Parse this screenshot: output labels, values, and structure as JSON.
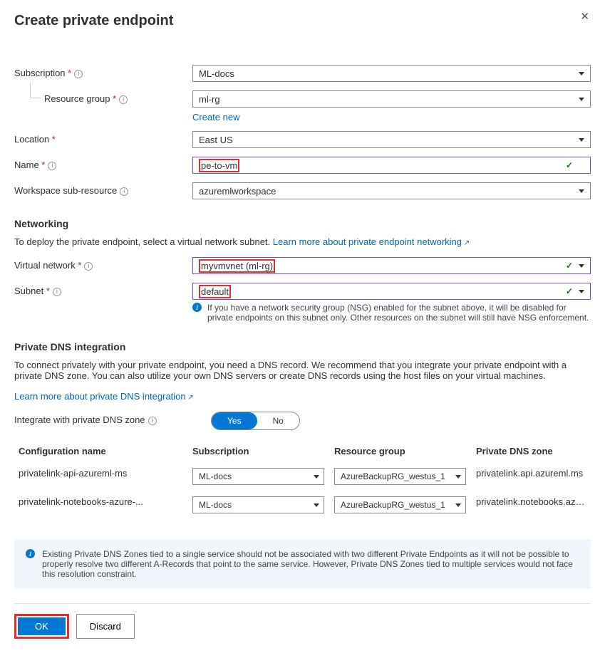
{
  "header": {
    "title": "Create private endpoint"
  },
  "fields": {
    "subscription": {
      "label": "Subscription",
      "value": "ML-docs"
    },
    "resourceGroup": {
      "label": "Resource group",
      "value": "ml-rg",
      "createNew": "Create new"
    },
    "location": {
      "label": "Location",
      "value": "East US"
    },
    "name": {
      "label": "Name",
      "value": "pe-to-vm"
    },
    "subresource": {
      "label": "Workspace sub-resource",
      "value": "azuremlworkspace"
    }
  },
  "networking": {
    "heading": "Networking",
    "desc": "To deploy the private endpoint, select a virtual network subnet. ",
    "learn": "Learn more about private endpoint networking",
    "vnet": {
      "label": "Virtual network",
      "value": "myvmvnet (ml-rg)"
    },
    "subnet": {
      "label": "Subnet",
      "value": "default"
    },
    "note": "If you have a network security group (NSG) enabled for the subnet above, it will be disabled for private endpoints on this subnet only. Other resources on the subnet will still have NSG enforcement."
  },
  "dns": {
    "heading": "Private DNS integration",
    "desc": "To connect privately with your private endpoint, you need a DNS record. We recommend that you integrate your private endpoint with a private DNS zone. You can also utilize your own DNS servers or create DNS records using the host files on your virtual machines.",
    "learn": "Learn more about private DNS integration",
    "toggleLabel": "Integrate with private DNS zone",
    "yes": "Yes",
    "no": "No",
    "cols": {
      "c1": "Configuration name",
      "c2": "Subscription",
      "c3": "Resource group",
      "c4": "Private DNS zone"
    },
    "rows": [
      {
        "name": "privatelink-api-azureml-ms",
        "sub": "ML-docs",
        "rg": "AzureBackupRG_westus_1",
        "zone": "privatelink.api.azureml.ms"
      },
      {
        "name": "privatelink-notebooks-azure-...",
        "sub": "ML-docs",
        "rg": "AzureBackupRG_westus_1",
        "zone": "privatelink.notebooks.azure.n..."
      }
    ],
    "callout": "Existing Private DNS Zones tied to a single service should not be associated with two different Private Endpoints as it will not be possible to properly resolve two different A-Records that point to the same service. However, Private DNS Zones tied to multiple services would not face this resolution constraint."
  },
  "footer": {
    "ok": "OK",
    "discard": "Discard"
  }
}
